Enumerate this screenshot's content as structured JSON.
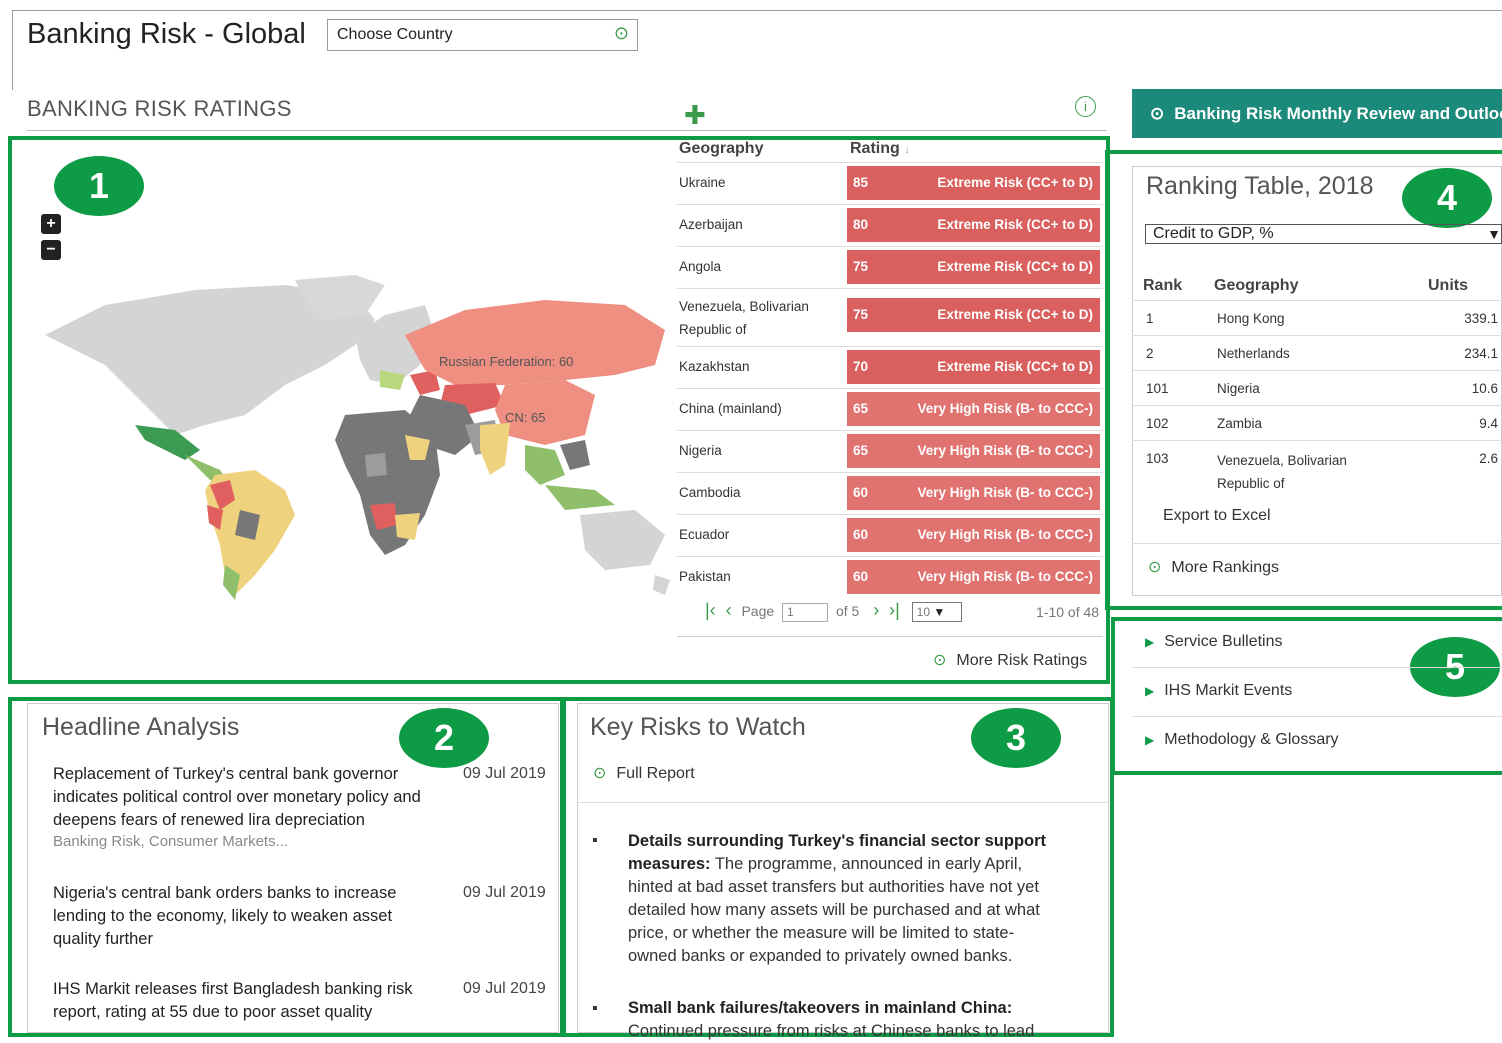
{
  "header": {
    "title": "Banking Risk - Global",
    "country_select": "Choose Country",
    "section_title": "BANKING RISK RATINGS",
    "outlook_button": "Banking Risk Monthly Review and Outlook"
  },
  "colors": {
    "badge_green": "#0e9b46",
    "extreme_risk": "#d9605e",
    "very_high_risk": "#e07270",
    "teal_button": "#1c8a7a"
  },
  "badges": [
    "1",
    "2",
    "3",
    "4",
    "5"
  ],
  "map": {
    "zoom_in": "+",
    "zoom_out": "−",
    "labels": [
      "Russian Federation: 60",
      "CN: 65"
    ]
  },
  "ratings": {
    "headers": {
      "geography": "Geography",
      "rating": "Rating"
    },
    "sort_icon": "↓",
    "rows": [
      {
        "geo": "Ukraine",
        "value": "85",
        "label": "Extreme Risk (CC+ to D)"
      },
      {
        "geo": "Azerbaijan",
        "value": "80",
        "label": "Extreme Risk (CC+ to D)"
      },
      {
        "geo": "Angola",
        "value": "75",
        "label": "Extreme Risk (CC+ to D)"
      },
      {
        "geo": "Venezuela, Bolivarian Republic of",
        "value": "75",
        "label": "Extreme Risk (CC+ to D)"
      },
      {
        "geo": "Kazakhstan",
        "value": "70",
        "label": "Extreme Risk (CC+ to D)"
      },
      {
        "geo": "China (mainland)",
        "value": "65",
        "label": "Very High Risk (B- to CCC-)"
      },
      {
        "geo": "Nigeria",
        "value": "65",
        "label": "Very High Risk (B- to CCC-)"
      },
      {
        "geo": "Cambodia",
        "value": "60",
        "label": "Very High Risk (B- to CCC-)"
      },
      {
        "geo": "Ecuador",
        "value": "60",
        "label": "Very High Risk (B- to CCC-)"
      },
      {
        "geo": "Pakistan",
        "value": "60",
        "label": "Very High Risk (B- to CCC-)"
      }
    ],
    "pager": {
      "page_label": "Page",
      "page_value": "1",
      "of_label": "of 5",
      "per_page": "10",
      "count": "1-10 of 48"
    },
    "more_link": "More Risk Ratings"
  },
  "ranking": {
    "title": "Ranking Table, 2018",
    "select": "Credit to GDP, %",
    "headers": {
      "rank": "Rank",
      "geography": "Geography",
      "units": "Units"
    },
    "rows": [
      {
        "rank": "1",
        "geo": "Hong Kong",
        "units": "339.1"
      },
      {
        "rank": "2",
        "geo": "Netherlands",
        "units": "234.1"
      },
      {
        "rank": "101",
        "geo": "Nigeria",
        "units": "10.6"
      },
      {
        "rank": "102",
        "geo": "Zambia",
        "units": "9.4"
      },
      {
        "rank": "103",
        "geo": "Venezuela, Bolivarian Republic of",
        "units": "2.6"
      }
    ],
    "export": "Export to Excel",
    "more": "More Rankings"
  },
  "links": [
    "Service Bulletins",
    "IHS Markit Events",
    "Methodology & Glossary"
  ],
  "headline": {
    "title": "Headline Analysis",
    "items": [
      {
        "text": "Replacement of Turkey's central bank governor indicates political control over monetary policy and deepens fears of renewed lira depreciation",
        "date": "09 Jul 2019",
        "category": "Banking Risk, Consumer Markets..."
      },
      {
        "text": "Nigeria's central bank orders banks to increase lending to the economy, likely to weaken asset quality further",
        "date": "09 Jul 2019"
      },
      {
        "text": "IHS Markit releases first Bangladesh banking risk report, rating at 55 due to poor asset quality",
        "date": "09 Jul 2019"
      }
    ]
  },
  "key_risks": {
    "title": "Key Risks to Watch",
    "full_report": "Full Report",
    "items": [
      {
        "bold": "Details surrounding Turkey's financial sector support measures:",
        "text": " The programme, announced in early April, hinted at bad asset transfers but authorities have not yet detailed how many assets will be purchased and at what price, or whether the measure will be limited to state-owned banks or expanded to privately owned banks."
      },
      {
        "bold": "Small bank failures/takeovers in mainland China:",
        "text": " Continued pressure from risks at Chinese banks to lead"
      }
    ]
  }
}
